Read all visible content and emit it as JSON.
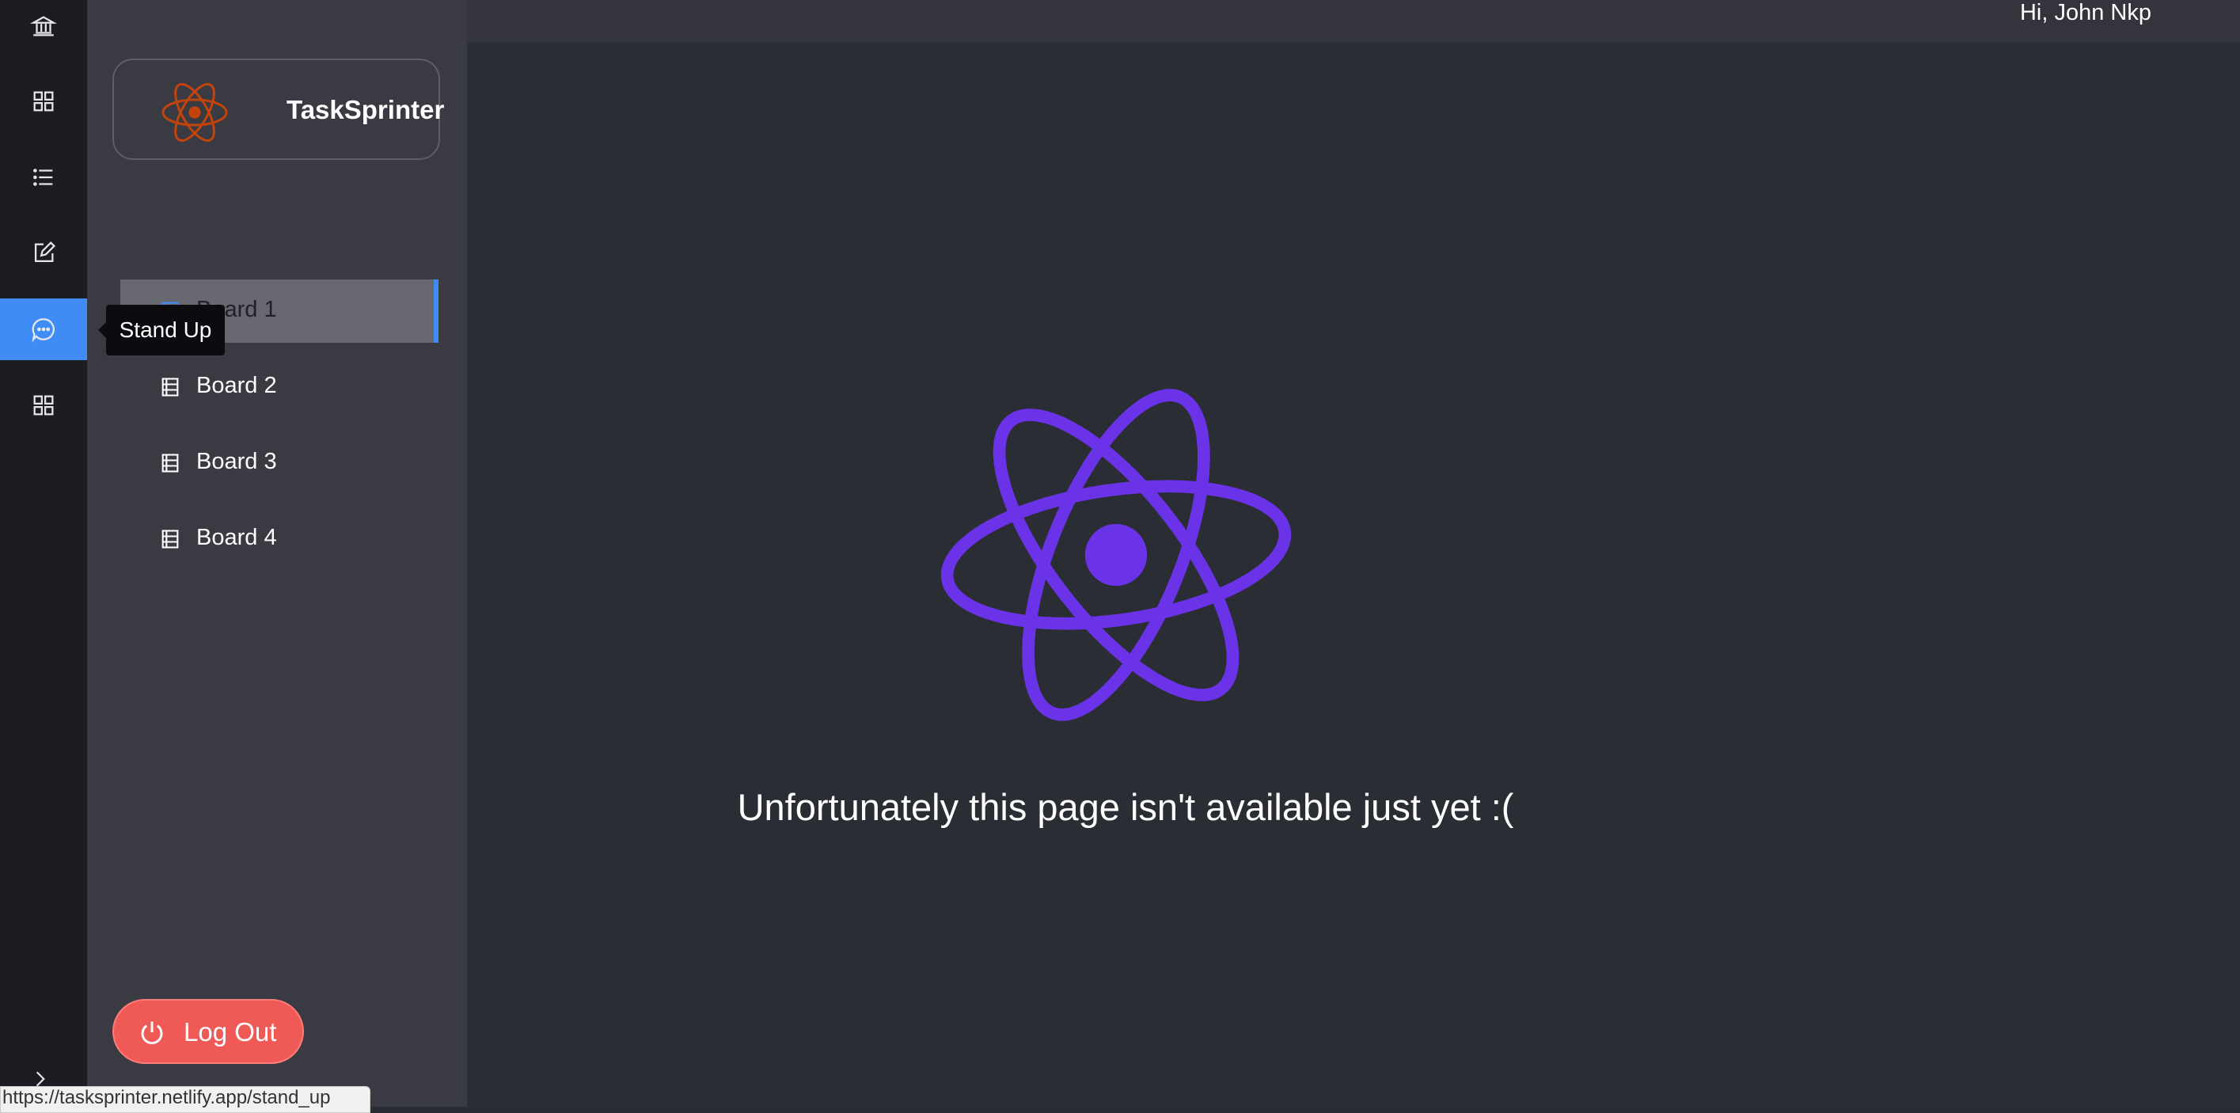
{
  "app": {
    "name": "TaskSprinter",
    "greeting": "Hi, John Nkp",
    "accent_color": "#3f8cf6",
    "logo_color_sidebar": "#c2440b",
    "logo_color_hero": "#6b33e8"
  },
  "rail": {
    "items": [
      {
        "icon": "bank-icon"
      },
      {
        "icon": "grid-icon"
      },
      {
        "icon": "list-icon"
      },
      {
        "icon": "edit-icon"
      },
      {
        "icon": "chat-icon",
        "active": true,
        "tooltip": "Stand Up"
      },
      {
        "icon": "apps-icon"
      }
    ],
    "expand_icon": "chevron-right-icon"
  },
  "sidebar": {
    "boards": [
      {
        "label": "Board 1",
        "active": true
      },
      {
        "label": "Board 2"
      },
      {
        "label": "Board 3"
      },
      {
        "label": "Board 4"
      }
    ],
    "logout_label": "Log Out"
  },
  "main": {
    "message": "Unfortunately this page isn't available just yet :("
  },
  "statusbar": {
    "url": "https://tasksprinter.netlify.app/stand_up"
  }
}
